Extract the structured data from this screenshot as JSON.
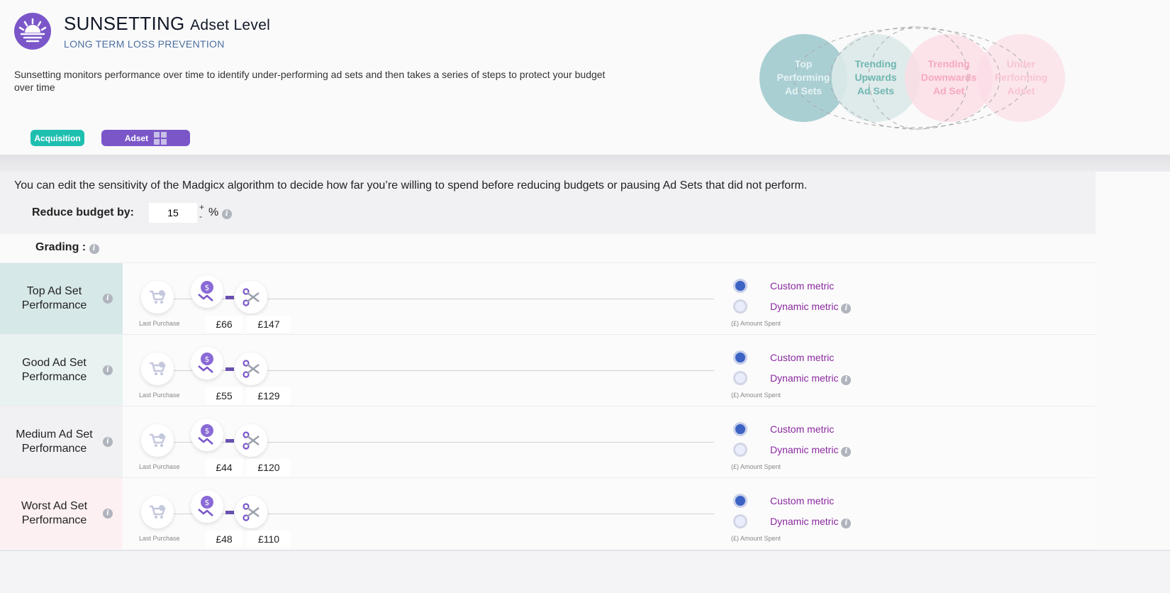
{
  "header": {
    "title": "SUNSETTING",
    "title_suffix": "Adset Level",
    "subtitle": "LONG TERM LOSS PREVENTION",
    "description": "Sunsetting monitors performance over time to identify under-performing ad sets and then takes a series of steps to protect your budget over time",
    "tags": [
      {
        "label": "Acquisition",
        "color": "#1fbfb0"
      },
      {
        "label": "Adset",
        "color": "#7a56c9"
      }
    ],
    "venn": [
      {
        "label": "Top Performing Ad Sets",
        "color": "#a9cfd3"
      },
      {
        "label": "Trending Upwards Ad Sets",
        "color": "#dce9e9"
      },
      {
        "label": "Trending Downwards Ad Set",
        "color": "#fbdde5"
      },
      {
        "label": "Under Performing Adset",
        "color": "#fbdde5"
      }
    ]
  },
  "settings": {
    "info": "You can edit the sensitivity of the Madgicx algorithm to decide how far you’re willing to spend before reducing budgets or pausing Ad Sets that did not perform.",
    "reduce_label": "Reduce budget by:",
    "reduce_value": "15",
    "plus": "+",
    "minus": "-",
    "unit": "%",
    "grading_label": "Grading :"
  },
  "rows": [
    {
      "label": "Top Ad Set Performance",
      "color": "#d7e8e8",
      "last_purchase": "Last Purchase",
      "min": "£66",
      "max": "£147",
      "custom": "Custom metric",
      "dynamic": "Dynamic metric",
      "selected": "custom",
      "amount_spent": "(£) Amount Spent"
    },
    {
      "label": "Good Ad Set Performance",
      "color": "#e8f2f1",
      "last_purchase": "Last Purchase",
      "min": "£55",
      "max": "£129",
      "custom": "Custom metric",
      "dynamic": "Dynamic metric",
      "selected": "custom",
      "amount_spent": "(£) Amount Spent"
    },
    {
      "label": "Medium Ad Set Performance",
      "color": "#f1f1f4",
      "last_purchase": "Last Purchase",
      "min": "£44",
      "max": "£120",
      "custom": "Custom metric",
      "dynamic": "Dynamic metric",
      "selected": "custom",
      "amount_spent": "(£) Amount Spent"
    },
    {
      "label": "Worst Ad Set Performance",
      "color": "#fcf0f2",
      "last_purchase": "Last Purchase",
      "min": "£48",
      "max": "£110",
      "custom": "Custom metric",
      "dynamic": "Dynamic metric",
      "selected": "custom",
      "amount_spent": "(£) Amount Spent"
    }
  ]
}
